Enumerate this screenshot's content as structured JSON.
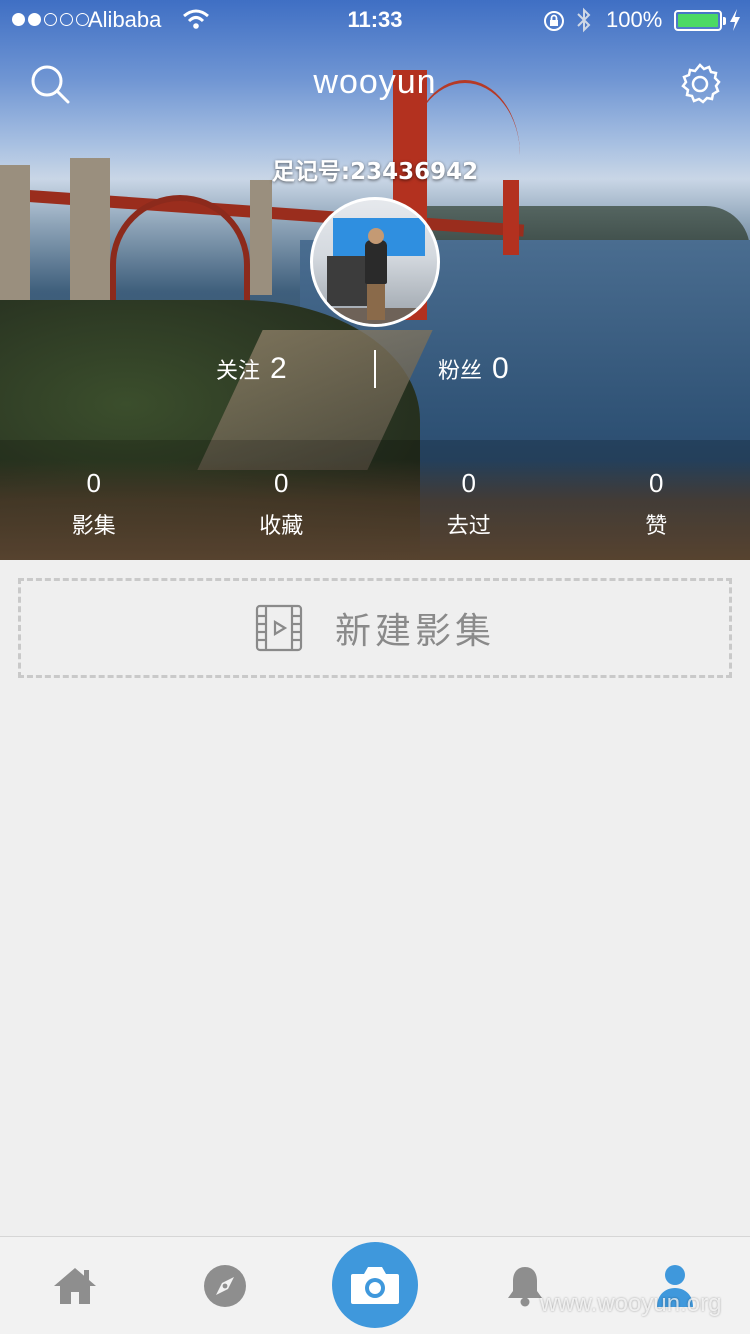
{
  "status_bar": {
    "carrier": "Alibaba",
    "time": "11:33",
    "battery_percent": "100%",
    "signal_bars_filled": 2,
    "signal_bars_total": 5
  },
  "nav": {
    "title": "wooyun",
    "left_icon": "search-icon",
    "right_icon": "gear-icon"
  },
  "profile": {
    "user_id_label": "足记号:23436942",
    "following_label": "关注",
    "following_count": "2",
    "fans_label": "粉丝",
    "fans_count": "0"
  },
  "stats": [
    {
      "value": "0",
      "label": "影集"
    },
    {
      "value": "0",
      "label": "收藏"
    },
    {
      "value": "0",
      "label": "去过"
    },
    {
      "value": "0",
      "label": "赞"
    }
  ],
  "new_album": {
    "label": "新建影集",
    "icon": "film-icon"
  },
  "tabbar": {
    "items": [
      {
        "icon": "home-icon"
      },
      {
        "icon": "compass-icon"
      },
      {
        "icon": "camera-icon"
      },
      {
        "icon": "bell-icon"
      },
      {
        "icon": "person-icon"
      }
    ],
    "active_color": "#3f98dc",
    "inactive_color": "#8e8e8e"
  },
  "watermark": "www.wooyun.org",
  "colors": {
    "accent": "#3f98dc",
    "battery": "#4cd964",
    "background": "#efefef"
  }
}
